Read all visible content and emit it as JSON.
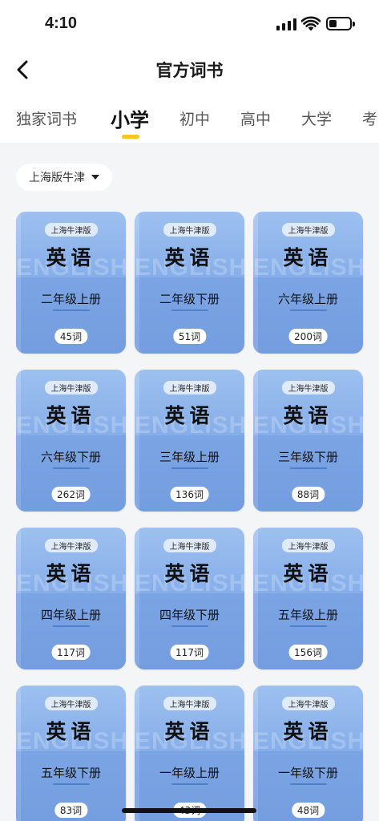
{
  "status_bar": {
    "time": "4:10"
  },
  "nav": {
    "title": "官方词书"
  },
  "tabs": [
    {
      "label": "独家词书"
    },
    {
      "label": "小学"
    },
    {
      "label": "初中"
    },
    {
      "label": "高中"
    },
    {
      "label": "大学"
    },
    {
      "label": "考"
    }
  ],
  "active_tab": 1,
  "filter": {
    "label": "上海版牛津"
  },
  "colors": {
    "accent": "#f8c623",
    "card": "#86aee9"
  },
  "books": [
    {
      "publisher": "上海牛津版",
      "subject": "英语",
      "watermark": "ENGLISH",
      "grade": "二年级上册",
      "count": "45词"
    },
    {
      "publisher": "上海牛津版",
      "subject": "英语",
      "watermark": "ENGLISH",
      "grade": "二年级下册",
      "count": "51词"
    },
    {
      "publisher": "上海牛津版",
      "subject": "英语",
      "watermark": "ENGLISH",
      "grade": "六年级上册",
      "count": "200词"
    },
    {
      "publisher": "上海牛津版",
      "subject": "英语",
      "watermark": "ENGLISH",
      "grade": "六年级下册",
      "count": "262词"
    },
    {
      "publisher": "上海牛津版",
      "subject": "英语",
      "watermark": "ENGLISH",
      "grade": "三年级上册",
      "count": "136词"
    },
    {
      "publisher": "上海牛津版",
      "subject": "英语",
      "watermark": "ENGLISH",
      "grade": "三年级下册",
      "count": "88词"
    },
    {
      "publisher": "上海牛津版",
      "subject": "英语",
      "watermark": "ENGLISH",
      "grade": "四年级上册",
      "count": "117词"
    },
    {
      "publisher": "上海牛津版",
      "subject": "英语",
      "watermark": "ENGLISH",
      "grade": "四年级下册",
      "count": "117词"
    },
    {
      "publisher": "上海牛津版",
      "subject": "英语",
      "watermark": "ENGLISH",
      "grade": "五年级上册",
      "count": "156词"
    },
    {
      "publisher": "上海牛津版",
      "subject": "英语",
      "watermark": "ENGLISH",
      "grade": "五年级下册",
      "count": "83词"
    },
    {
      "publisher": "上海牛津版",
      "subject": "英语",
      "watermark": "ENGLISH",
      "grade": "一年级上册",
      "count": "43词"
    },
    {
      "publisher": "上海牛津版",
      "subject": "英语",
      "watermark": "ENGLISH",
      "grade": "一年级下册",
      "count": "48词"
    }
  ]
}
